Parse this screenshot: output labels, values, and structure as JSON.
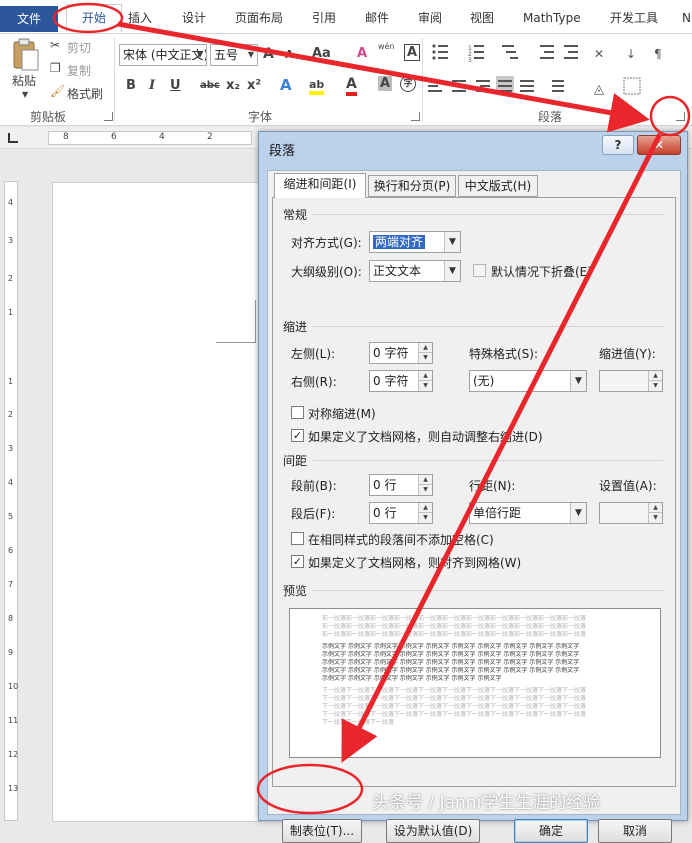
{
  "ribbon_tabs": {
    "file": "文件",
    "home": "开始",
    "insert": "插入",
    "design": "设计",
    "layout": "页面布局",
    "references": "引用",
    "mailings": "邮件",
    "review": "审阅",
    "view": "视图",
    "mathtype": "MathType",
    "developer": "开发工具",
    "more": "N"
  },
  "clipboard": {
    "paste": "粘贴",
    "cut": "剪切",
    "copy": "复制",
    "format_painter": "格式刷",
    "group": "剪贴板"
  },
  "font": {
    "name": "宋体 (中文正文)",
    "size": "五号",
    "group": "字体",
    "grow": "A",
    "shrink": "A",
    "case": "Aa",
    "clear": "A",
    "phonetic": "wén",
    "border_char": "A",
    "bold": "B",
    "italic": "I",
    "underline": "U",
    "strike": "abc",
    "subscript": "x₂",
    "superscript": "x²",
    "effects": "A",
    "highlight": "ab",
    "color": "A",
    "shading": "A",
    "enclose": "字"
  },
  "paragraph": {
    "group": "段落"
  },
  "ruler": {
    "numbers": [
      "8",
      "6",
      "4",
      "2"
    ],
    "vnumbers": [
      "4",
      "3",
      "2",
      "1",
      "1",
      "2",
      "3",
      "4",
      "5",
      "6",
      "7",
      "8",
      "9",
      "10",
      "11",
      "12",
      "13"
    ]
  },
  "dialog": {
    "title": "段落",
    "help": "?",
    "close": "✕",
    "tabs": [
      "缩进和间距(I)",
      "换行和分页(P)",
      "中文版式(H)"
    ],
    "general": {
      "heading": "常规",
      "alignment_label": "对齐方式(G):",
      "alignment_value": "两端对齐",
      "outline_label": "大纲级别(O):",
      "outline_value": "正文文本",
      "collapse_label": "默认情况下折叠(E)"
    },
    "indent": {
      "heading": "缩进",
      "left_label": "左侧(L):",
      "left_value": "0 字符",
      "right_label": "右侧(R):",
      "right_value": "0 字符",
      "special_label": "特殊格式(S):",
      "special_value": "(无)",
      "by_label": "缩进值(Y):",
      "by_value": "",
      "mirror_label": "对称缩进(M)",
      "auto_adjust_label": "如果定义了文档网格，则自动调整右缩进(D)"
    },
    "spacing": {
      "heading": "间距",
      "before_label": "段前(B):",
      "before_value": "0 行",
      "after_label": "段后(F):",
      "after_value": "0 行",
      "line_label": "行距(N):",
      "line_value": "单倍行距",
      "at_label": "设置值(A):",
      "at_value": "",
      "no_space_label": "在相同样式的段落间不添加空格(C)",
      "snap_grid_label": "如果定义了文档网格，则对齐到网格(W)"
    },
    "preview": {
      "heading": "预览",
      "prev_line": "前一段落前一段落前一段落前一段落前一段落前一段落前一段落前一段落前一段落前一段落前一段落",
      "sample_line": "示例文字 示例文字 示例文字 示例文字 示例文字 示例文字 示例文字 示例文字 示例文字 示例文字",
      "sample_last": "示例文字 示例文字 示例文字 示例文字 示例文字 示例文字 示例文字",
      "next_line": "下一段落下一段落下一段落下一段落下一段落下一段落下一段落下一段落下一段落下一段落下一段落",
      "next_last": "下一段落下一段落下一段落"
    },
    "buttons": {
      "tabs": "制表位(T)...",
      "default": "设为默认值(D)",
      "ok": "确定",
      "cancel": "取消"
    },
    "checks": {
      "mirror": false,
      "auto_adjust": true,
      "collapse": false,
      "no_space": false,
      "snap_grid": true
    }
  },
  "watermark": "头条号 / Janni学生生涯的经验",
  "colors": {
    "accent": "#2b579a",
    "annotation": "#e8262b",
    "dialog_frame": "#bcd2ea"
  }
}
